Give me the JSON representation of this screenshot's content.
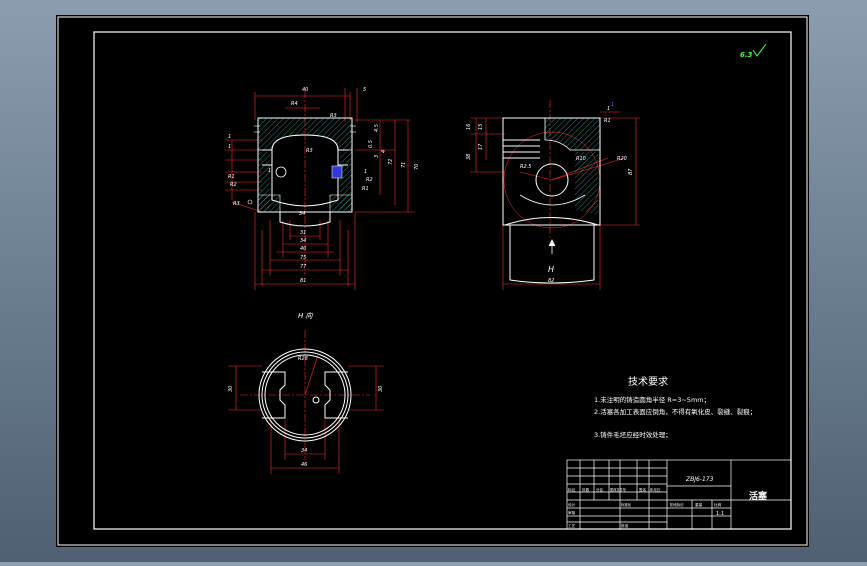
{
  "drawing": {
    "roughness_mark": "6.3",
    "view_label": "H 向",
    "section_marker": "H",
    "section_marker_top": "1",
    "technical": {
      "title": "技术要求",
      "items": [
        "1.未注明的铸造圆角半径 R=3~5mm；",
        "2.活塞各加工表面应倒角，不得有氧化皮、裂缝、裂痕；",
        "3.铸件毛坯应经时效处理；"
      ]
    },
    "front_dims": [
      "40",
      "5",
      "R4",
      "R3",
      "1",
      "1",
      "R3",
      "4.5",
      "0.5",
      "4",
      "3",
      "72",
      "71",
      "70",
      "1",
      "1",
      "R1",
      "R2",
      "R2",
      "R1",
      "34",
      "31",
      "34",
      "40",
      "75",
      "77",
      "81",
      "R3"
    ],
    "side_dims": [
      "1",
      "16",
      "15",
      "38",
      "17",
      "R2.5",
      "R10",
      "R20",
      "R1",
      "87",
      "82"
    ],
    "bottom_dims": [
      "R28",
      "30",
      "30",
      "34",
      "46"
    ],
    "title_block": {
      "part_no": "ZBJ6-173",
      "part_name": "活塞",
      "scale": "1:1",
      "labels": [
        "标记",
        "处数",
        "分区",
        "更改文件号",
        "签名",
        "年月日",
        "设计",
        "审核",
        "工艺",
        "标准化",
        "批准",
        "阶段标记",
        "重量",
        "比例"
      ]
    }
  },
  "colors": {
    "outline": "#ffffff",
    "dimension": "#ff2a2a",
    "hatch": "#3fd7c8",
    "accent": "#49ff3a",
    "highlight": "#3a4bff",
    "paper": "#000000"
  }
}
